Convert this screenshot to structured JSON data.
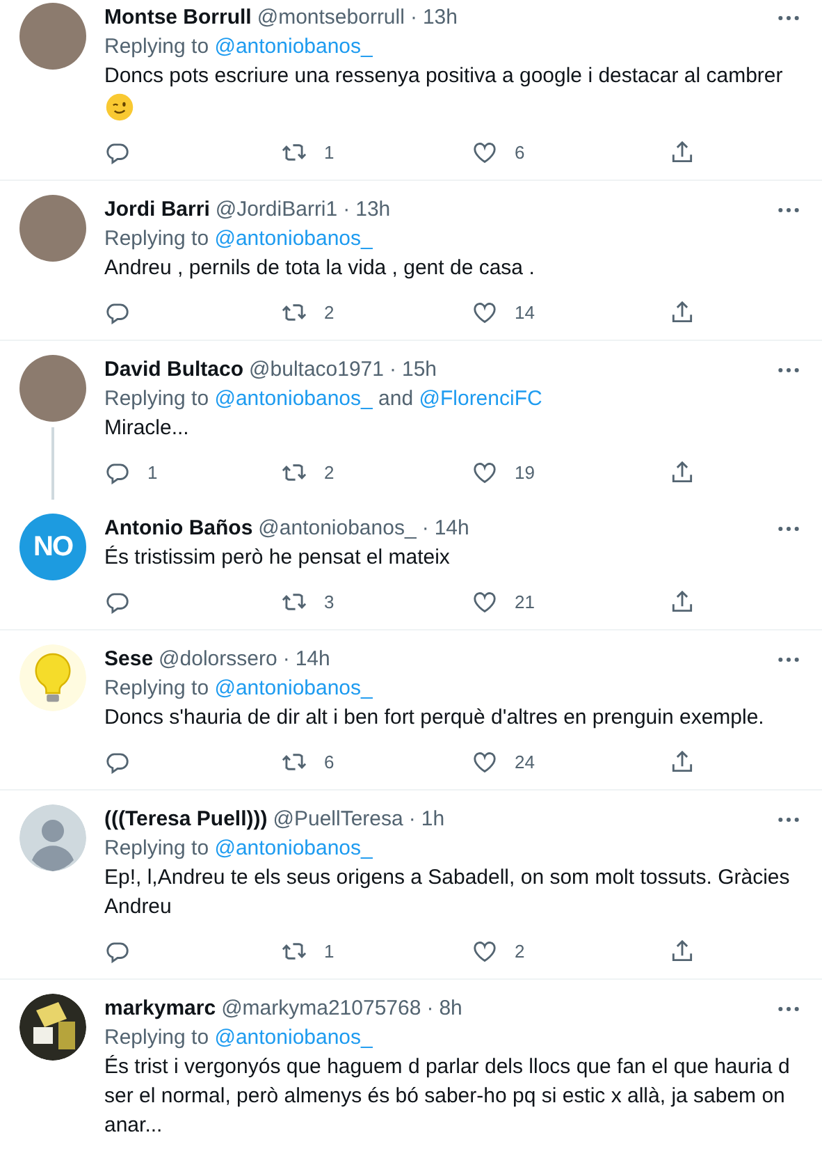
{
  "tweets": [
    {
      "avatar": {
        "kind": "photo"
      },
      "separator": "·",
      "name": "Montse Borrull",
      "handle": "@montseborrull",
      "time": "13h",
      "replying": {
        "prefix": "Replying to",
        "mentions": [
          "@antoniobanos_"
        ]
      },
      "text": "Doncs pots escriure una ressenya positiva a google i destacar al cambrer",
      "wink_emoji": true,
      "retweets": "1",
      "likes": "6",
      "thread_below": false
    },
    {
      "avatar": {
        "kind": "photo"
      },
      "separator": "·",
      "name": "Jordi Barri",
      "handle": "@JordiBarri1",
      "time": "13h",
      "replying": {
        "prefix": "Replying to",
        "mentions": [
          "@antoniobanos_"
        ]
      },
      "text": "Andreu , pernils de tota la vida , gent de casa .",
      "retweets": "2",
      "likes": "14",
      "thread_below": false
    },
    {
      "avatar": {
        "kind": "photo"
      },
      "separator": "·",
      "name": "David Bultaco",
      "handle": "@bultaco1971",
      "time": "15h",
      "replying": {
        "prefix": "Replying to",
        "mentions": [
          "@antoniobanos_",
          "@FlorenciFC"
        ],
        "joiner": "and"
      },
      "text": "Miracle...",
      "replies": "1",
      "retweets": "2",
      "likes": "19",
      "thread_below": true
    },
    {
      "avatar": {
        "kind": "logo",
        "text": "NO"
      },
      "separator": "·",
      "name": "Antonio Baños",
      "handle": "@antoniobanos_",
      "time": "14h",
      "text": "És tristissim però he pensat el mateix",
      "retweets": "3",
      "likes": "21",
      "thread_below": false
    },
    {
      "avatar": {
        "kind": "bulb"
      },
      "separator": "·",
      "name": "Sese",
      "handle": "@dolorssero",
      "time": "14h",
      "replying": {
        "prefix": "Replying to",
        "mentions": [
          "@antoniobanos_"
        ]
      },
      "text": "Doncs s'hauria de dir alt i ben fort perquè d'altres en prenguin exemple.",
      "retweets": "6",
      "likes": "24",
      "thread_below": false
    },
    {
      "avatar": {
        "kind": "default"
      },
      "separator": "·",
      "name": "(((Teresa Puell)))",
      "handle": "@PuellTeresa",
      "time": "1h",
      "replying": {
        "prefix": "Replying to",
        "mentions": [
          "@antoniobanos_"
        ]
      },
      "text": "Ep!, l,Andreu te els seus origens a Sabadell, on som molt tossuts. Gràcies Andreu",
      "retweets": "1",
      "likes": "2",
      "thread_below": false
    },
    {
      "avatar": {
        "kind": "drawing"
      },
      "separator": "·",
      "name": "markymarc",
      "handle": "@markyma21075768",
      "time": "8h",
      "replying": {
        "prefix": "Replying to",
        "mentions": [
          "@antoniobanos_"
        ]
      },
      "text": "És trist i vergonyós que haguem d parlar dels llocs que fan el que hauria d ser el normal, però almenys és bó saber-ho pq si estic x allà, ja sabem on anar...",
      "thread_below": false
    }
  ]
}
